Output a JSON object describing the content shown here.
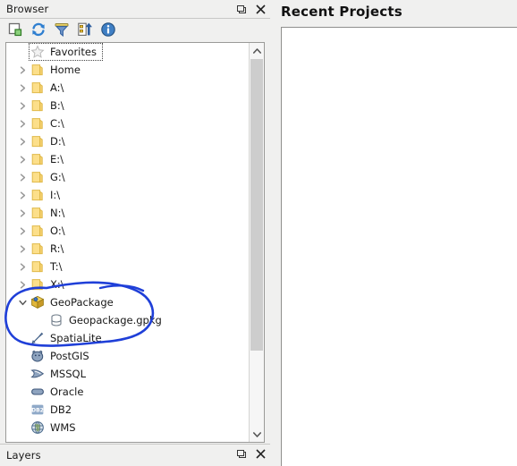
{
  "window": {
    "background_color": "#f0f0ef"
  },
  "browser_panel": {
    "title": "Browser",
    "undock_button_name": "undock-icon",
    "close_button_name": "close-icon",
    "toolbar": [
      {
        "name": "add-layer-icon",
        "tooltip": "Add Selected Layers"
      },
      {
        "name": "refresh-icon",
        "tooltip": "Refresh"
      },
      {
        "name": "filter-icon",
        "tooltip": "Filter Browser"
      },
      {
        "name": "collapse-all-icon",
        "tooltip": "Collapse All"
      },
      {
        "name": "info-icon",
        "tooltip": "Enable/disable properties widget"
      }
    ],
    "tree": [
      {
        "label": "Favorites",
        "icon": "star-icon",
        "expander": "none",
        "indent": 1,
        "focused": true
      },
      {
        "label": "Home",
        "icon": "folder-icon",
        "expander": "collapsed",
        "indent": 1,
        "focused": false
      },
      {
        "label": "A:\\",
        "icon": "folder-icon",
        "expander": "collapsed",
        "indent": 1,
        "focused": false
      },
      {
        "label": "B:\\",
        "icon": "folder-icon",
        "expander": "collapsed",
        "indent": 1,
        "focused": false
      },
      {
        "label": "C:\\",
        "icon": "folder-icon",
        "expander": "collapsed",
        "indent": 1,
        "focused": false
      },
      {
        "label": "D:\\",
        "icon": "folder-icon",
        "expander": "collapsed",
        "indent": 1,
        "focused": false
      },
      {
        "label": "E:\\",
        "icon": "folder-icon",
        "expander": "collapsed",
        "indent": 1,
        "focused": false
      },
      {
        "label": "G:\\",
        "icon": "folder-icon",
        "expander": "collapsed",
        "indent": 1,
        "focused": false
      },
      {
        "label": "I:\\",
        "icon": "folder-icon",
        "expander": "collapsed",
        "indent": 1,
        "focused": false
      },
      {
        "label": "N:\\",
        "icon": "folder-icon",
        "expander": "collapsed",
        "indent": 1,
        "focused": false
      },
      {
        "label": "O:\\",
        "icon": "folder-icon",
        "expander": "collapsed",
        "indent": 1,
        "focused": false
      },
      {
        "label": "R:\\",
        "icon": "folder-icon",
        "expander": "collapsed",
        "indent": 1,
        "focused": false
      },
      {
        "label": "T:\\",
        "icon": "folder-icon",
        "expander": "collapsed",
        "indent": 1,
        "focused": false
      },
      {
        "label": "X:\\",
        "icon": "folder-icon",
        "expander": "collapsed",
        "indent": 1,
        "focused": false
      },
      {
        "label": "GeoPackage",
        "icon": "geopackage-icon",
        "expander": "expanded",
        "indent": 1,
        "focused": false
      },
      {
        "label": "Geopackage.gpkg",
        "icon": "database-icon",
        "expander": "none",
        "indent": 2,
        "focused": false
      },
      {
        "label": "SpatiaLite",
        "icon": "spatialite-icon",
        "expander": "none",
        "indent": 1,
        "focused": false
      },
      {
        "label": "PostGIS",
        "icon": "postgis-icon",
        "expander": "none",
        "indent": 1,
        "focused": false
      },
      {
        "label": "MSSQL",
        "icon": "mssql-icon",
        "expander": "none",
        "indent": 1,
        "focused": false
      },
      {
        "label": "Oracle",
        "icon": "oracle-icon",
        "expander": "none",
        "indent": 1,
        "focused": false
      },
      {
        "label": "DB2",
        "icon": "db2-icon",
        "expander": "none",
        "indent": 1,
        "focused": false
      },
      {
        "label": "WMS",
        "icon": "wms-icon",
        "expander": "none",
        "indent": 1,
        "focused": false
      }
    ],
    "scrollbar": {
      "up_arrow_name": "scroll-up-arrow",
      "down_arrow_name": "scroll-down-arrow",
      "thumb_name": "scroll-thumb"
    }
  },
  "layers_panel": {
    "title": "Layers",
    "undock_button_name": "undock-icon",
    "close_button_name": "close-icon"
  },
  "recent_projects": {
    "title": "Recent Projects",
    "items": []
  },
  "annotation": {
    "shape": "hand-drawn-ellipse",
    "color": "#1f3fd8",
    "highlights": "GeoPackage and Geopackage.gpkg tree entries"
  }
}
